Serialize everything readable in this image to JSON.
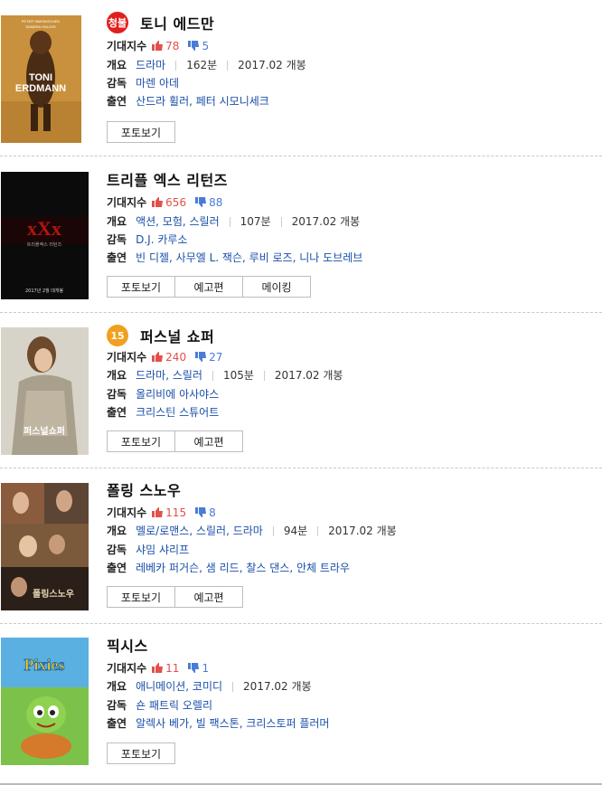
{
  "labels": {
    "expect": "기대지수",
    "summary": "개요",
    "director": "감독",
    "cast": "출연"
  },
  "movies": [
    {
      "rating_badge": "청불",
      "title": "토니 에드만",
      "likes": "78",
      "dislikes": "5",
      "genre": "드라마",
      "runtime": "162분",
      "release": "2017.02 개봉",
      "director": "마렌 아데",
      "cast": "산드라 휠러, 페터 시모니세크",
      "buttons": [
        "포토보기"
      ],
      "poster": {
        "line1": "PETER SIMONISCHEK",
        "line2": "SANDRA HÜLLER",
        "title1": "TONI",
        "title2": "ERDMANN"
      }
    },
    {
      "title": "트리플 엑스 리턴즈",
      "likes": "656",
      "dislikes": "88",
      "genre": "액션, 모험, 스릴러",
      "runtime": "107분",
      "release": "2017.02 개봉",
      "director": "D.J. 카루소",
      "cast": "빈 디젤, 사무엘 L. 잭슨, 루비 로즈, 니나 도브레브",
      "buttons": [
        "포토보기",
        "예고편",
        "메이킹"
      ],
      "poster": {
        "logo": "xXx",
        "sub": "트리플엑스 리턴즈",
        "date": "2017년 2월 대개봉"
      }
    },
    {
      "rating_badge": "15",
      "title": "퍼스널 쇼퍼",
      "likes": "240",
      "dislikes": "27",
      "genre": "드라마, 스릴러",
      "runtime": "105분",
      "release": "2017.02 개봉",
      "director": "올리비에 아사야스",
      "cast": "크리스틴 스튜어트",
      "buttons": [
        "포토보기",
        "예고편"
      ],
      "poster": {
        "title": "퍼스널쇼퍼"
      }
    },
    {
      "title": "폴링 스노우",
      "likes": "115",
      "dislikes": "8",
      "genre": "멜로/로맨스, 스릴러, 드라마",
      "runtime": "94분",
      "release": "2017.02 개봉",
      "director": "샤밈 샤리프",
      "cast": "레베카 퍼거슨, 샘 리드, 찰스 댄스, 안체 트라우",
      "buttons": [
        "포토보기",
        "예고편"
      ],
      "poster": {
        "title": "폴링스노우"
      }
    },
    {
      "title": "픽시스",
      "likes": "11",
      "dislikes": "1",
      "genre": "애니메이션, 코미디",
      "release": "2017.02 개봉",
      "director": "숀 패트릭 오렐리",
      "cast": "알렉사 베가, 빌 팩스톤, 크리스토퍼 플러머",
      "buttons": [
        "포토보기"
      ],
      "poster": {
        "title": "Pixies"
      }
    }
  ],
  "colors": {
    "like": "#e2504b",
    "dislike": "#4a7bd6",
    "link": "#1a4fa8",
    "badge_adult": "#e1201d",
    "badge_15": "#f0a01e"
  }
}
